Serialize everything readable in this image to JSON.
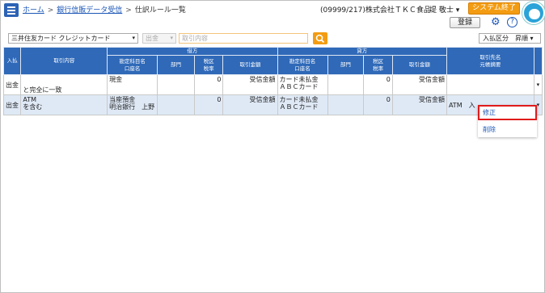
{
  "header": {
    "breadcrumb": [
      "ホーム",
      "銀行信販データ受信",
      "仕訳ルール一覧"
    ],
    "company": "(09999/217)株式会社ＴＫＣ食品",
    "user": "堤 敬士 ▾",
    "exit_label": "システム終了",
    "register_label": "登録",
    "help_symbol": "?",
    "gear_symbol": "⚙"
  },
  "filters": {
    "card_select": "三井住友カード クレジットカード",
    "inout_select": "出金",
    "search_placeholder": "取引内容",
    "sort_label": "入払区分　昇順 ▾"
  },
  "table": {
    "headers": {
      "inout": "入払",
      "content": "取引内容",
      "debit": "借方",
      "credit": "貸方",
      "account": "勘定科目名",
      "account_sub": "口座名",
      "dept": "部門",
      "tax": "税区",
      "tax_sub": "税率",
      "amount": "取引金額",
      "partner": "取引先名",
      "partner_sub": "元帳摘要"
    },
    "rows": [
      {
        "inout": "出金",
        "content": "と完全に一致",
        "debit_account": "現金",
        "debit_account2": "",
        "debit_dept": "",
        "debit_tax": "0",
        "debit_amount": "受信金額",
        "credit_account": "カード未払金",
        "credit_account2": "ＡＢＣカード",
        "credit_dept": "",
        "credit_tax": "0",
        "credit_amount": "受信金額",
        "partner": ""
      },
      {
        "inout": "出金",
        "content": "ATM",
        "content2": "を含む",
        "debit_account": "当座預金",
        "debit_account2": "明治銀行　上野",
        "debit_dept": "",
        "debit_tax": "0",
        "debit_amount": "受信金額",
        "credit_account": "カード未払金",
        "credit_account2": "ＡＢＣカード",
        "credit_dept": "",
        "credit_tax": "0",
        "credit_amount": "受信金額",
        "partner": "ATM　入"
      }
    ]
  },
  "context_menu": {
    "edit": "修正",
    "delete": "削除"
  },
  "colors": {
    "header_blue": "#2f69b8",
    "accent_orange": "#f39c12",
    "highlight_red": "#e01b1b"
  }
}
